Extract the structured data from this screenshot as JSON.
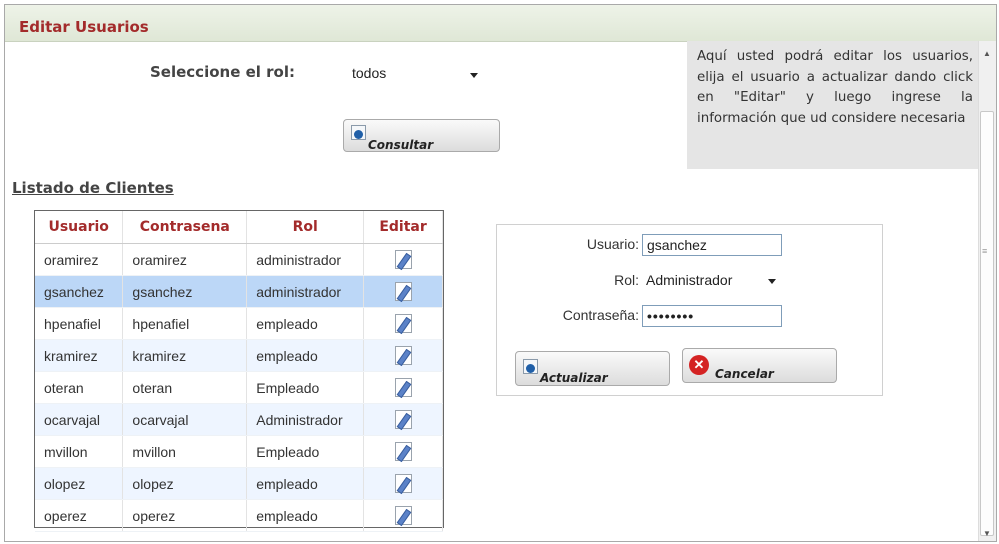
{
  "page": {
    "title": "Editar Usuarios"
  },
  "help": {
    "text": "Aquí usted podrá editar los usuarios, elija el usuario a actualizar dando click en \"Editar\" y luego ingrese la información que ud considere necesaria"
  },
  "filter": {
    "label": "Seleccione el rol:",
    "selected": "todos",
    "button_label": "Consultar"
  },
  "list": {
    "title": "Listado de Clientes",
    "columns": [
      "Usuario",
      "Contrasena",
      "Rol",
      "Editar"
    ],
    "rows": [
      {
        "usuario": "oramirez",
        "contrasena": "oramirez",
        "rol": "administrador"
      },
      {
        "usuario": "gsanchez",
        "contrasena": "gsanchez",
        "rol": "administrador"
      },
      {
        "usuario": "hpenafiel",
        "contrasena": "hpenafiel",
        "rol": "empleado"
      },
      {
        "usuario": "kramirez",
        "contrasena": "kramirez",
        "rol": "empleado"
      },
      {
        "usuario": "oteran",
        "contrasena": "oteran",
        "rol": "Empleado"
      },
      {
        "usuario": "ocarvajal",
        "contrasena": "ocarvajal",
        "rol": "Administrador"
      },
      {
        "usuario": "mvillon",
        "contrasena": "mvillon",
        "rol": "Empleado"
      },
      {
        "usuario": "olopez",
        "contrasena": "olopez",
        "rol": "empleado"
      },
      {
        "usuario": "operez",
        "contrasena": "operez",
        "rol": "empleado"
      }
    ],
    "selected_index": 1
  },
  "form": {
    "usuario_label": "Usuario:",
    "usuario_value": "gsanchez",
    "rol_label": "Rol:",
    "rol_value": "Administrador",
    "password_label": "Contraseña:",
    "password_mask": "••••••••",
    "update_label": "Actualizar",
    "cancel_label": "Cancelar"
  },
  "colors": {
    "accent": "#a32b2b",
    "selected_row": "#bcd7f7",
    "alt_row": "#eef5ff",
    "help_bg": "#e5e5e5"
  },
  "icons": {
    "edit": "edit-pencil-icon",
    "consult": "search-icon",
    "update": "refresh-icon",
    "cancel": "cancel-x-icon"
  }
}
